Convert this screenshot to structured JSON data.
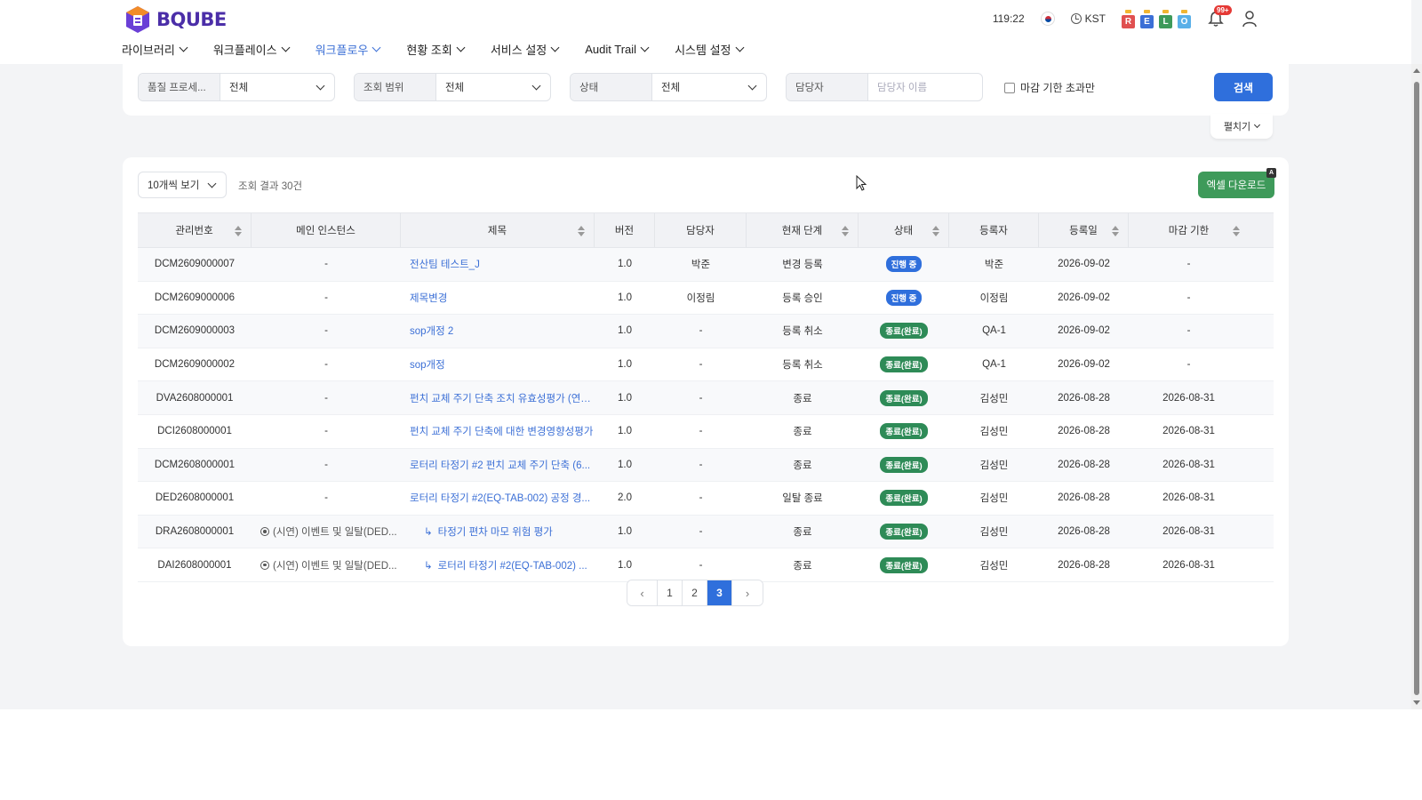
{
  "brand": {
    "name": "BQUBE",
    "color": "#4b2ea8"
  },
  "utility": {
    "clock": "119:22",
    "timezone": "KST",
    "role_badges": [
      {
        "letter": "R",
        "color": "#e05050"
      },
      {
        "letter": "E",
        "color": "#3b6fd6"
      },
      {
        "letter": "L",
        "color": "#3e9a5a"
      },
      {
        "letter": "O",
        "color": "#5ab0e8"
      }
    ],
    "notification_count": "99+"
  },
  "nav": [
    {
      "label": "라이브러리",
      "active": false
    },
    {
      "label": "워크플레이스",
      "active": false
    },
    {
      "label": "워크플로우",
      "active": true
    },
    {
      "label": "현황 조회",
      "active": false
    },
    {
      "label": "서비스 설정",
      "active": false
    },
    {
      "label": "Audit Trail",
      "active": false
    },
    {
      "label": "시스템 설정",
      "active": false
    }
  ],
  "filters": {
    "quality_process": {
      "label": "품질 프로세...",
      "value": "전체"
    },
    "scope": {
      "label": "조회 범위",
      "value": "전체"
    },
    "status": {
      "label": "상태",
      "value": "전체"
    },
    "assignee": {
      "label": "담당자",
      "placeholder": "담당자 이름"
    },
    "deadline_only": "마감 기한 초과만",
    "search_button": "검색",
    "expand_button": "펼치기"
  },
  "results": {
    "page_size": "10개씩 보기",
    "count_text": "조회 결과 30건",
    "excel_button": "엑셀 다운로드",
    "excel_badge": "A",
    "columns": [
      "관리번호",
      "메인 인스턴스",
      "제목",
      "버전",
      "담당자",
      "현재 단계",
      "상태",
      "등록자",
      "등록일",
      "마감 기한"
    ],
    "rows": [
      {
        "id": "DCM2609000007",
        "main": "-",
        "title": "전산팀 테스트_J",
        "sub": false,
        "version": "1.0",
        "assignee": "박준",
        "stage": "변경 등록",
        "status": "진행 중",
        "registrant": "박준",
        "date": "2026-09-02",
        "deadline": "-"
      },
      {
        "id": "DCM2609000006",
        "main": "-",
        "title": "제목변경",
        "sub": false,
        "version": "1.0",
        "assignee": "이정림",
        "stage": "등록 승인",
        "status": "진행 중",
        "registrant": "이정림",
        "date": "2026-09-02",
        "deadline": "-"
      },
      {
        "id": "DCM2609000003",
        "main": "-",
        "title": "sop개정 2",
        "sub": false,
        "version": "1.0",
        "assignee": "-",
        "stage": "등록 취소",
        "status": "종료(완료)",
        "registrant": "QA-1",
        "date": "2026-09-02",
        "deadline": "-"
      },
      {
        "id": "DCM2609000002",
        "main": "-",
        "title": "sop개정",
        "sub": false,
        "version": "1.0",
        "assignee": "-",
        "stage": "등록 취소",
        "status": "종료(완료)",
        "registrant": "QA-1",
        "date": "2026-09-02",
        "deadline": "-"
      },
      {
        "id": "DVA2608000001",
        "main": "-",
        "title": "펀치 교체 주기 단축 조치 유효성평가 (연속...",
        "sub": false,
        "version": "1.0",
        "assignee": "-",
        "stage": "종료",
        "status": "종료(완료)",
        "registrant": "김성민",
        "date": "2026-08-28",
        "deadline": "2026-08-31"
      },
      {
        "id": "DCI2608000001",
        "main": "-",
        "title": "펀치 교체 주기 단축에 대한 변경영향성평가",
        "sub": false,
        "version": "1.0",
        "assignee": "-",
        "stage": "종료",
        "status": "종료(완료)",
        "registrant": "김성민",
        "date": "2026-08-28",
        "deadline": "2026-08-31"
      },
      {
        "id": "DCM2608000001",
        "main": "-",
        "title": "로터리 타정기 #2 펀치 교체 주기 단축 (6...",
        "sub": false,
        "version": "1.0",
        "assignee": "-",
        "stage": "종료",
        "status": "종료(완료)",
        "registrant": "김성민",
        "date": "2026-08-28",
        "deadline": "2026-08-31"
      },
      {
        "id": "DED2608000001",
        "main": "-",
        "title": "로터리 타정기 #2(EQ-TAB-002) 공정 경...",
        "sub": false,
        "version": "2.0",
        "assignee": "-",
        "stage": "일탈 종료",
        "status": "종료(완료)",
        "registrant": "김성민",
        "date": "2026-08-28",
        "deadline": "2026-08-31"
      },
      {
        "id": "DRA2608000001",
        "main": "(시연) 이벤트 및 일탈(DED...",
        "title": "타정기 편차 마모 위험 평가",
        "sub": true,
        "version": "1.0",
        "assignee": "-",
        "stage": "종료",
        "status": "종료(완료)",
        "registrant": "김성민",
        "date": "2026-08-28",
        "deadline": "2026-08-31"
      },
      {
        "id": "DAI2608000001",
        "main": "(시연) 이벤트 및 일탈(DED...",
        "title": "로터리 타정기 #2(EQ-TAB-002) ...",
        "sub": true,
        "version": "1.0",
        "assignee": "-",
        "stage": "종료",
        "status": "종료(완료)",
        "registrant": "김성민",
        "date": "2026-08-28",
        "deadline": "2026-08-31"
      }
    ],
    "status_colors": {
      "진행 중": "#2f6fdc",
      "종료(완료)": "#2e8b57"
    }
  },
  "pagination": {
    "prev": "‹",
    "pages": [
      "1",
      "2",
      "3"
    ],
    "current": "3",
    "next": "›"
  }
}
